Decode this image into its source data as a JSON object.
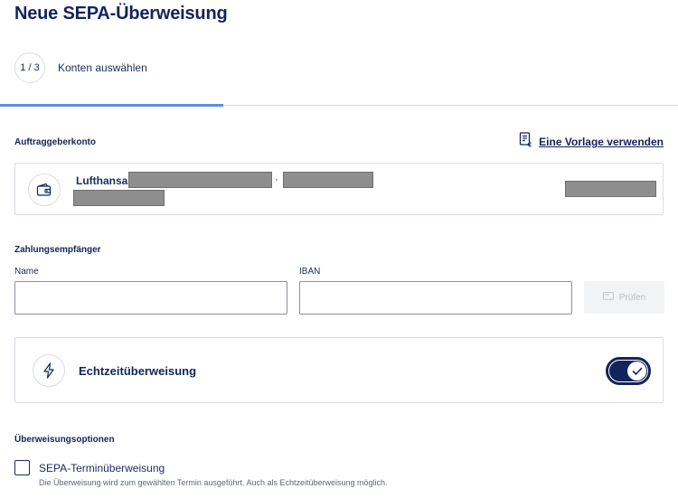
{
  "page": {
    "title": "Neue SEPA-Überweisung"
  },
  "stepper": {
    "step": "1 / 3",
    "label": "Konten auswählen",
    "progress": 0.33
  },
  "ordering_account": {
    "section_label": "Auftraggeberkonto",
    "template_link": "Eine Vorlage verwenden",
    "account_name": "Lufthansa",
    "separator": "·"
  },
  "payee": {
    "section_label": "Zahlungsempfänger",
    "name_label": "Name",
    "name_value": "",
    "iban_label": "IBAN",
    "iban_value": "",
    "check_button": "Prüfen"
  },
  "instant_transfer": {
    "label": "Echtzeitüberweisung",
    "enabled": true
  },
  "options": {
    "section_label": "Überweisungsoptionen",
    "scheduled_label": "SEPA-Terminüberweisung",
    "scheduled_help": "Die Überweisung wird zum gewählten Termin ausgeführt. Auch als Echtzeitüberweisung möglich.",
    "scheduled_checked": false
  },
  "colors": {
    "primary": "#13235b",
    "accent": "#5a8ee0",
    "border": "#d8dce3",
    "redaction": "#8e8e8e"
  },
  "icons": {
    "template": "document-euro-icon",
    "wallet": "wallet-icon",
    "bolt": "lightning-icon",
    "check": "checkmark-icon",
    "check_button": "card-icon"
  }
}
